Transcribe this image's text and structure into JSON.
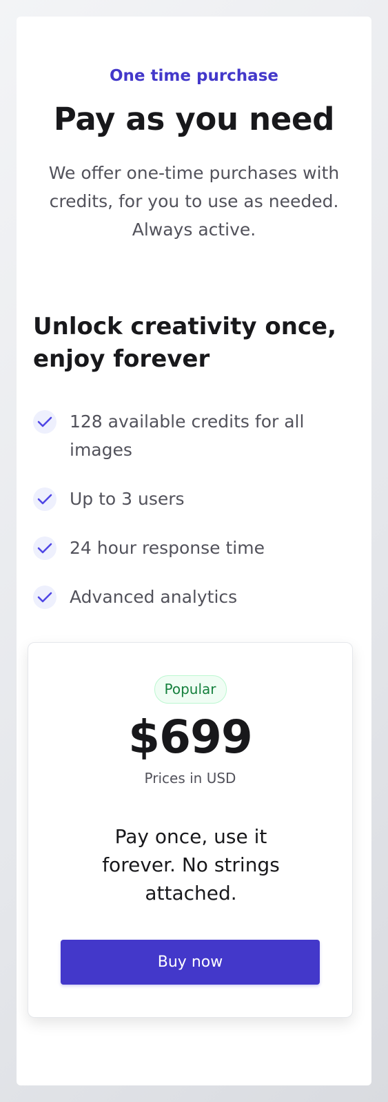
{
  "header": {
    "eyebrow": "One time purchase",
    "title": "Pay as you need",
    "description": "We offer one-time purchases with credits, for you to use as needed. Always active."
  },
  "features": {
    "title": "Unlock creativity once, enjoy forever",
    "items": [
      {
        "label": "128 available credits for all images",
        "icon": "check-icon"
      },
      {
        "label": "Up to 3 users",
        "icon": "check-icon"
      },
      {
        "label": "24 hour response time",
        "icon": "check-icon"
      },
      {
        "label": "Advanced analytics",
        "icon": "check-icon"
      }
    ]
  },
  "pricing": {
    "badge": "Popular",
    "price": "$699",
    "currency_note": "Prices in USD",
    "tagline": "Pay once, use it forever. No strings attached.",
    "button_label": "Buy now"
  },
  "colors": {
    "accent": "#4338ca",
    "badge_text": "#15803d",
    "badge_bg": "#f0fdf4",
    "check_bg": "#eef0fd",
    "check_stroke": "#4f46e5"
  }
}
